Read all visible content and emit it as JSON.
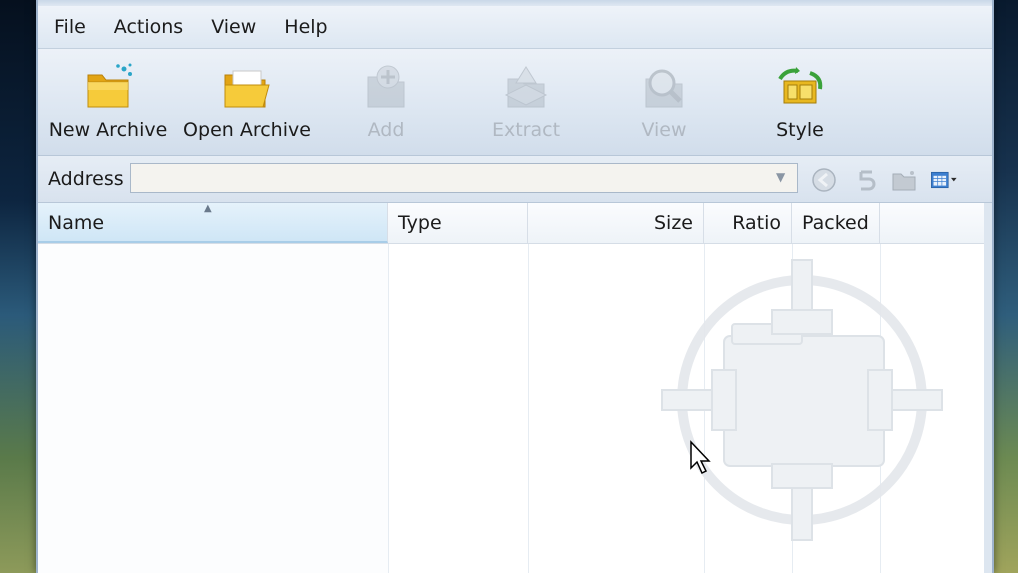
{
  "menu": {
    "items": [
      "File",
      "Actions",
      "View",
      "Help"
    ]
  },
  "toolbar": {
    "buttons": [
      {
        "label": "New Archive",
        "icon": "new-archive-folder-icon",
        "enabled": true
      },
      {
        "label": "Open Archive",
        "icon": "open-archive-folder-icon",
        "enabled": true
      },
      {
        "label": "Add",
        "icon": "add-icon",
        "enabled": false
      },
      {
        "label": "Extract",
        "icon": "extract-icon",
        "enabled": false
      },
      {
        "label": "View",
        "icon": "view-icon",
        "enabled": false
      },
      {
        "label": "Style",
        "icon": "style-icon",
        "enabled": true
      }
    ]
  },
  "address": {
    "label": "Address",
    "value": "",
    "icons": [
      "back-icon",
      "up-icon",
      "new-folder-icon",
      "view-mode-icon"
    ]
  },
  "list": {
    "columns": [
      "Name",
      "Type",
      "Size",
      "Ratio",
      "Packed"
    ],
    "sorted_column": "Name",
    "rows": []
  },
  "colors": {
    "accent": "#cfe6f6",
    "folder": "#f2c230",
    "disabled_text": "#b0b8c2"
  }
}
